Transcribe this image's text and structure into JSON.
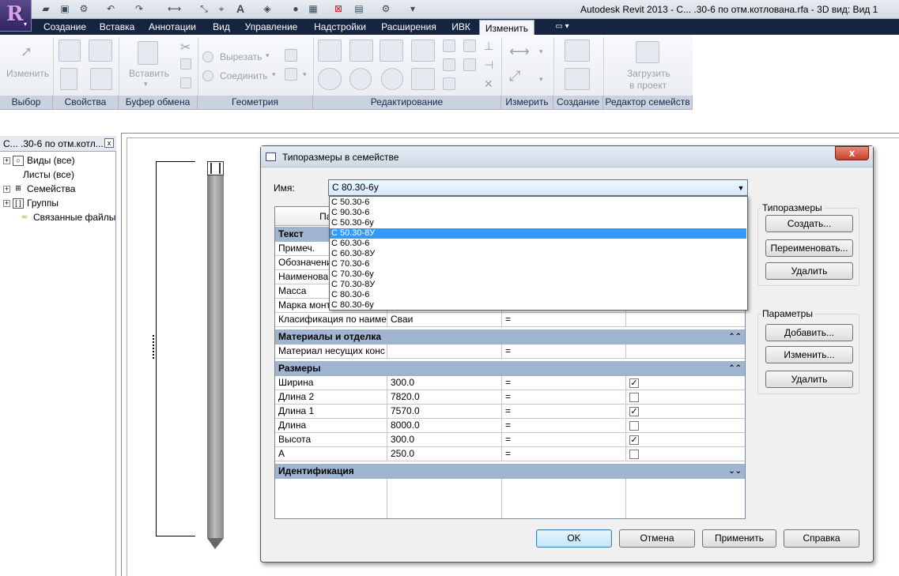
{
  "window": {
    "title": "Autodesk Revit 2013 -     С... .30-6 по отм.котлована.rfa - 3D вид: Вид 1"
  },
  "qat": {
    "text_tool": "A"
  },
  "ribbon": {
    "tabs": [
      {
        "label": "Создание"
      },
      {
        "label": "Вставка"
      },
      {
        "label": "Аннотации"
      },
      {
        "label": "Вид"
      },
      {
        "label": "Управление"
      },
      {
        "label": "Надстройки"
      },
      {
        "label": "Расширения"
      },
      {
        "label": "ИВК"
      },
      {
        "label": "Изменить"
      }
    ],
    "buttons": {
      "modify": "Изменить",
      "paste": "Вставить",
      "cut": "Вырезать",
      "join": "Соединить",
      "load_line1": "Загрузить",
      "load_line2": "в проект"
    },
    "panels": [
      {
        "label": "Выбор"
      },
      {
        "label": "Свойства"
      },
      {
        "label": "Буфер обмена"
      },
      {
        "label": "Геометрия"
      },
      {
        "label": "Редактирование"
      },
      {
        "label": "Измерить"
      },
      {
        "label": "Создание"
      },
      {
        "label": "Редактор семейств"
      }
    ]
  },
  "browser": {
    "title": "С... .30-6 по отм.котл...",
    "items": [
      {
        "label": "Виды (все)"
      },
      {
        "label": "Листы (все)"
      },
      {
        "label": "Семейства"
      },
      {
        "label": "Группы"
      },
      {
        "label": "Связанные файлы"
      }
    ]
  },
  "dialog": {
    "title": "Типоразмеры в семействе",
    "close_symbol": "x",
    "name_label": "Имя:",
    "name_value": "С 80.30-6у",
    "dropdown_options": [
      "С 50.30-6",
      "С 90.30-6",
      "С 50.30-6у",
      "С 50.30-8У",
      "С 60.30-6",
      "С 60.30-8У",
      "С 70.30-6",
      "С 70.30-6у",
      "С 70.30-8У",
      "С 80.30-6",
      "С 80.30-6у"
    ],
    "dropdown_selected_index": 3,
    "table_header_param": "Пара",
    "groups": {
      "text": "Текст",
      "materials": "Материалы и отделка",
      "dimensions": "Размеры",
      "identity": "Идентификация"
    },
    "text_rows": [
      {
        "name": "Примеч."
      },
      {
        "name": "Обозначени"
      },
      {
        "name": "Наименова"
      },
      {
        "name": "Масса"
      },
      {
        "name": "Марка монт"
      }
    ],
    "classification_row": {
      "name": "Класификация по наиме",
      "value": "Сваи",
      "formula": "="
    },
    "material_row": {
      "name": "Материал несущих конс",
      "value": "",
      "formula": "="
    },
    "dimension_rows": [
      {
        "name": "Ширина",
        "value": "300.0",
        "formula": "=",
        "checked": true
      },
      {
        "name": "Длина 2",
        "value": "7820.0",
        "formula": "=",
        "checked": false
      },
      {
        "name": "Длина 1",
        "value": "7570.0",
        "formula": "=",
        "checked": true
      },
      {
        "name": "Длина",
        "value": "8000.0",
        "formula": "=",
        "checked": false
      },
      {
        "name": "Высота",
        "value": "300.0",
        "formula": "=",
        "checked": true
      },
      {
        "name": "А",
        "value": "250.0",
        "formula": "=",
        "checked": false
      }
    ],
    "types_group": {
      "label": "Типоразмеры",
      "create": "Создать...",
      "rename": "Переименовать...",
      "delete": "Удалить"
    },
    "params_group": {
      "label": "Параметры",
      "add": "Добавить...",
      "modify": "Изменить...",
      "delete": "Удалить"
    },
    "footer": {
      "ok": "OK",
      "cancel": "Отмена",
      "apply": "Применить",
      "help": "Справка"
    }
  },
  "colors": {
    "ribbon_tabs_bg": "#16243f",
    "group_header_bg": "#9fb4cf",
    "selection": "#3399ff"
  }
}
